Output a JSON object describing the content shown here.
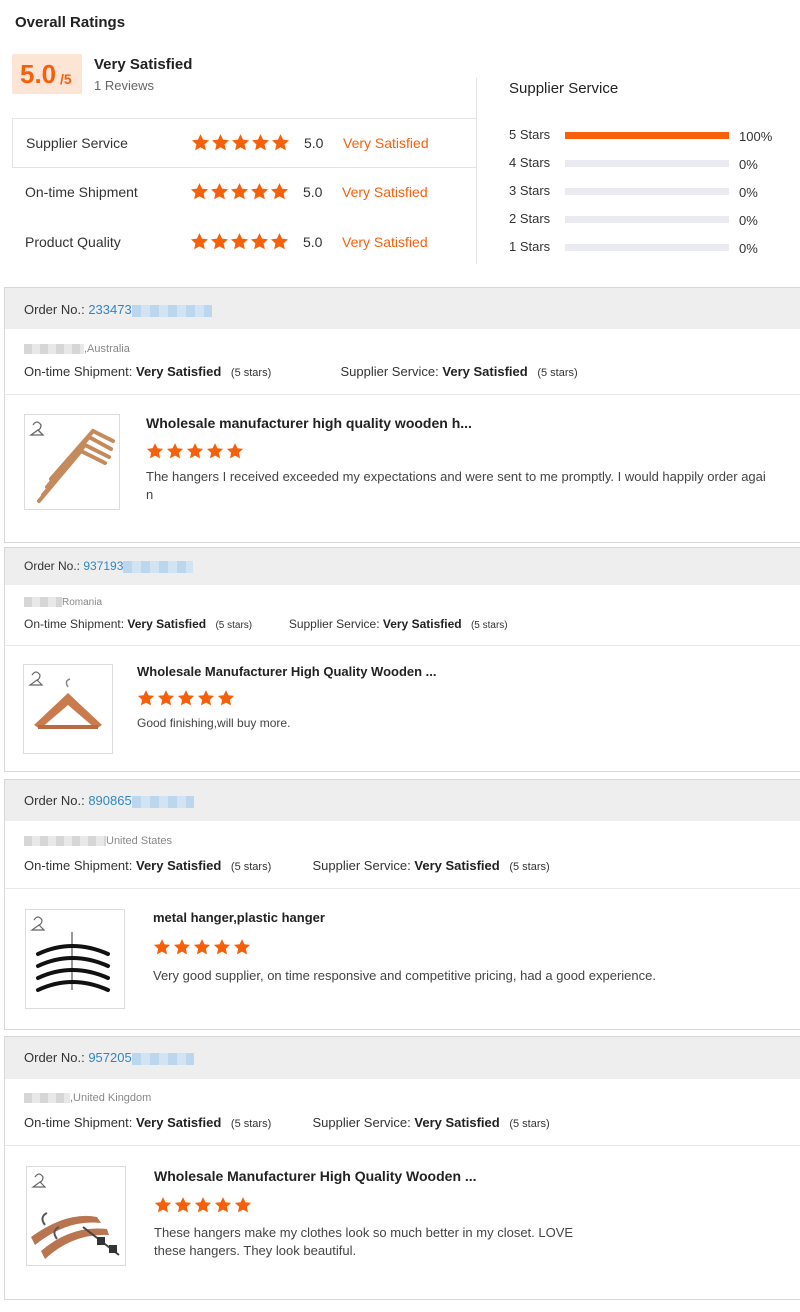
{
  "summary": {
    "title": "Overall Ratings",
    "score": "5.0",
    "score_max": "/5",
    "overall_label": "Very Satisfied",
    "review_count": "1 Reviews",
    "rows": [
      {
        "label": "Supplier Service",
        "value": "5.0",
        "satisfaction": "Very Satisfied",
        "stars": 5
      },
      {
        "label": "On-time Shipment",
        "value": "5.0",
        "satisfaction": "Very Satisfied",
        "stars": 5
      },
      {
        "label": "Product Quality",
        "value": "5.0",
        "satisfaction": "Very Satisfied",
        "stars": 5
      }
    ]
  },
  "distribution": {
    "title": "Supplier Service",
    "rows": [
      {
        "label": "5  Stars",
        "percent": "100%",
        "fill": 1.0
      },
      {
        "label": "4  Stars",
        "percent": "0%",
        "fill": 0
      },
      {
        "label": "3  Stars",
        "percent": "0%",
        "fill": 0
      },
      {
        "label": "2  Stars",
        "percent": "0%",
        "fill": 0
      },
      {
        "label": "1  Stars",
        "percent": "0%",
        "fill": 0
      }
    ]
  },
  "orders": [
    {
      "order_label": "Order No.:",
      "order_no": "233473",
      "country": ",Australia",
      "ontime_label": "On-time Shipment:",
      "ontime_value": "Very Satisfied",
      "ontime_stars": "(5 stars)",
      "service_label": "Supplier Service:",
      "service_value": "Very Satisfied",
      "service_stars": "(5 stars)",
      "product_title": "Wholesale manufacturer high quality wooden h...",
      "rating": 5,
      "comment": "The hangers I received exceeded my expectations and were sent to me promptly. I would happily order agai n",
      "image_icon": "wooden-hangers-icon"
    },
    {
      "order_label": "Order No.:",
      "order_no": "937193",
      "country": "Romania",
      "ontime_label": "On-time Shipment:",
      "ontime_value": "Very Satisfied",
      "ontime_stars": "(5 stars)",
      "service_label": "Supplier Service:",
      "service_value": "Very Satisfied",
      "service_stars": "(5 stars)",
      "product_title": "Wholesale Manufacturer High Quality Wooden ...",
      "rating": 5,
      "comment": "Good finishing,will buy more.",
      "image_icon": "wooden-hanger-icon"
    },
    {
      "order_label": "Order No.:",
      "order_no": "890865",
      "country": "United States",
      "ontime_label": "On-time Shipment:",
      "ontime_value": "Very Satisfied",
      "ontime_stars": "(5 stars)",
      "service_label": "Supplier Service:",
      "service_value": "Very Satisfied",
      "service_stars": "(5 stars)",
      "product_title": "metal hanger,plastic hanger",
      "rating": 5,
      "comment": "Very good supplier, on time responsive and competitive pricing, had a good experience.",
      "image_icon": "metal-hangers-icon"
    },
    {
      "order_label": "Order No.:",
      "order_no": "957205",
      "country": ",United Kingdom",
      "ontime_label": "On-time Shipment:",
      "ontime_value": "Very Satisfied",
      "ontime_stars": "(5 stars)",
      "service_label": "Supplier Service:",
      "service_value": "Very Satisfied",
      "service_stars": "(5 stars)",
      "product_title": "Wholesale Manufacturer High Quality Wooden ...",
      "rating": 5,
      "comment": "These hangers make my clothes look so much better in my closet. LOVE these hangers. They look beautiful.",
      "image_icon": "wooden-hangers-clip-icon"
    }
  ],
  "colors": {
    "accent": "#f7600b",
    "link": "#2f86c5",
    "header_bg": "#eeeeee"
  }
}
